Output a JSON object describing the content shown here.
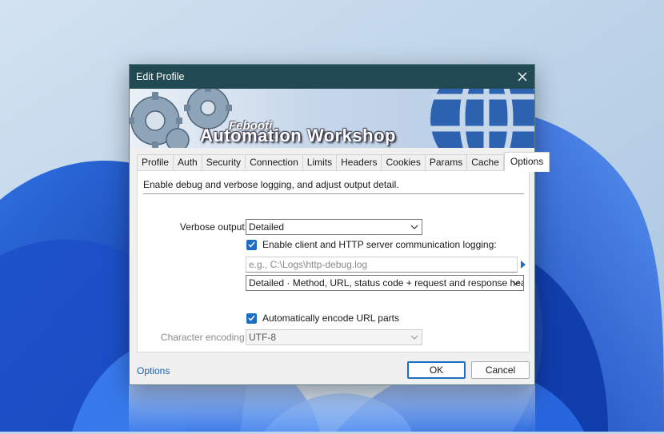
{
  "window": {
    "title": "Edit Profile"
  },
  "banner": {
    "brand_small": "Febooti",
    "brand_big": "Automation Workshop"
  },
  "tabs": [
    {
      "label": "Profile",
      "active": false
    },
    {
      "label": "Auth",
      "active": false
    },
    {
      "label": "Security",
      "active": false
    },
    {
      "label": "Connection",
      "active": false
    },
    {
      "label": "Limits",
      "active": false
    },
    {
      "label": "Headers",
      "active": false
    },
    {
      "label": "Cookies",
      "active": false
    },
    {
      "label": "Params",
      "active": false
    },
    {
      "label": "Cache",
      "active": false
    },
    {
      "label": "Options",
      "active": true
    }
  ],
  "options": {
    "description": "Enable debug and verbose logging, and adjust output detail.",
    "verbose_label": "Verbose output:",
    "verbose_value": "Detailed",
    "logging_checkbox_label": "Enable client and HTTP server communication logging:",
    "logging_checked": true,
    "log_path_placeholder": "e.g., C:\\Logs\\http-debug.log",
    "log_detail_value": "Detailed · Method, URL, status code + request and response header",
    "encode_checkbox_label": "Automatically encode URL parts",
    "encode_checked": true,
    "encoding_label": "Character encoding:",
    "encoding_value": "UTF-8"
  },
  "footer": {
    "options_link": "Options",
    "ok_label": "OK",
    "cancel_label": "Cancel"
  },
  "colors": {
    "titlebar": "#214a54",
    "accent": "#1f6dc2",
    "link": "#1c5ea8"
  }
}
